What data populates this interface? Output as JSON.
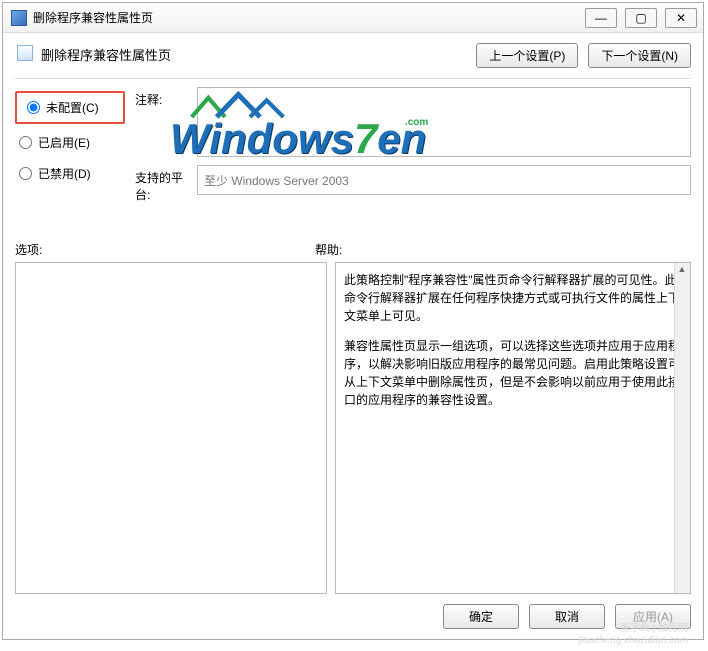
{
  "window": {
    "title": "删除程序兼容性属性页"
  },
  "toolbar": {
    "header_title": "删除程序兼容性属性页",
    "prev_label": "上一个设置(P)",
    "next_label": "下一个设置(N)"
  },
  "radios": {
    "not_configured": "未配置(C)",
    "enabled": "已启用(E)",
    "disabled": "已禁用(D)"
  },
  "fields": {
    "comment_label": "注释:",
    "platform_label": "支持的平台:",
    "platform_value": "至少 Windows Server 2003"
  },
  "section": {
    "options_label": "选项:",
    "help_label": "帮助:"
  },
  "help": {
    "p1": "此策略控制\"程序兼容性\"属性页命令行解释器扩展的可见性。此命令行解释器扩展在任何程序快捷方式或可执行文件的属性上下文菜单上可见。",
    "p2": "兼容性属性页显示一组选项，可以选择这些选项并应用于应用程序，以解决影响旧版应用程序的最常见问题。启用此策略设置可从上下文菜单中删除属性页，但是不会影响以前应用于使用此接口的应用程序的兼容性设置。"
  },
  "footer": {
    "ok": "确定",
    "cancel": "取消",
    "apply": "应用(A)"
  },
  "watermark": {
    "main": "Windows",
    "seven": "7",
    "en": "en",
    "com": ".com"
  },
  "source_watermark": {
    "line1": "查字典 | 教程网",
    "line2": "jiaocheng.chazidian.com"
  }
}
